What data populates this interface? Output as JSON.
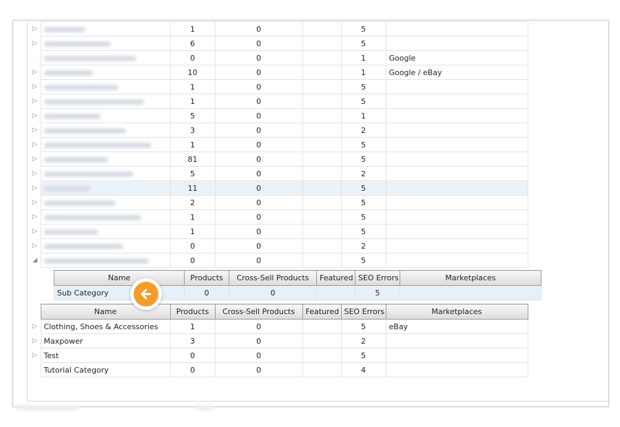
{
  "top_rows": [
    {
      "name": "",
      "expander": "▷",
      "products": "1",
      "cross_sell": "0",
      "featured": "",
      "seo_errors": "5",
      "marketplaces": ""
    },
    {
      "name": "",
      "expander": "▷",
      "products": "6",
      "cross_sell": "0",
      "featured": "",
      "seo_errors": "5",
      "marketplaces": ""
    },
    {
      "name": "",
      "expander": "",
      "products": "0",
      "cross_sell": "0",
      "featured": "",
      "seo_errors": "1",
      "marketplaces": "Google"
    },
    {
      "name": "",
      "expander": "▷",
      "products": "10",
      "cross_sell": "0",
      "featured": "",
      "seo_errors": "1",
      "marketplaces": "Google / eBay"
    },
    {
      "name": "",
      "expander": "▷",
      "products": "1",
      "cross_sell": "0",
      "featured": "",
      "seo_errors": "5",
      "marketplaces": ""
    },
    {
      "name": "",
      "expander": "▷",
      "products": "1",
      "cross_sell": "0",
      "featured": "",
      "seo_errors": "5",
      "marketplaces": ""
    },
    {
      "name": "",
      "expander": "▷",
      "products": "5",
      "cross_sell": "0",
      "featured": "",
      "seo_errors": "1",
      "marketplaces": ""
    },
    {
      "name": "",
      "expander": "▷",
      "products": "3",
      "cross_sell": "0",
      "featured": "",
      "seo_errors": "2",
      "marketplaces": ""
    },
    {
      "name": "",
      "expander": "▷",
      "products": "1",
      "cross_sell": "0",
      "featured": "",
      "seo_errors": "5",
      "marketplaces": ""
    },
    {
      "name": "",
      "expander": "▷",
      "products": "81",
      "cross_sell": "0",
      "featured": "",
      "seo_errors": "5",
      "marketplaces": ""
    },
    {
      "name": "",
      "expander": "▷",
      "products": "5",
      "cross_sell": "0",
      "featured": "",
      "seo_errors": "2",
      "marketplaces": ""
    },
    {
      "name": "",
      "expander": "▷",
      "products": "11",
      "cross_sell": "0",
      "featured": "",
      "seo_errors": "5",
      "marketplaces": ""
    },
    {
      "name": "",
      "expander": "▷",
      "products": "2",
      "cross_sell": "0",
      "featured": "",
      "seo_errors": "5",
      "marketplaces": ""
    },
    {
      "name": "",
      "expander": "▷",
      "products": "1",
      "cross_sell": "0",
      "featured": "",
      "seo_errors": "5",
      "marketplaces": ""
    },
    {
      "name": "",
      "expander": "▷",
      "products": "1",
      "cross_sell": "0",
      "featured": "",
      "seo_errors": "5",
      "marketplaces": ""
    },
    {
      "name": "",
      "expander": "▷",
      "products": "0",
      "cross_sell": "0",
      "featured": "",
      "seo_errors": "2",
      "marketplaces": ""
    },
    {
      "name": "",
      "expander": "◢",
      "products": "0",
      "cross_sell": "0",
      "featured": "",
      "seo_errors": "5",
      "marketplaces": ""
    }
  ],
  "selected_top_row": 11,
  "columns": {
    "name": "Name",
    "products": "Products",
    "cross_sell": "Cross-Sell Products",
    "featured": "Featured",
    "seo_errors": "SEO Errors",
    "marketplaces": "Marketplaces"
  },
  "sub_row": {
    "name": "Sub Category",
    "products": "0",
    "cross_sell": "0",
    "featured": "",
    "seo_errors": "5",
    "marketplaces": ""
  },
  "bottom_rows": [
    {
      "name": "Clothing, Shoes & Accessories",
      "expander": "▷",
      "products": "1",
      "cross_sell": "0",
      "featured": "",
      "seo_errors": "5",
      "marketplaces": "eBay"
    },
    {
      "name": "Maxpower",
      "expander": "▷",
      "products": "3",
      "cross_sell": "0",
      "featured": "",
      "seo_errors": "2",
      "marketplaces": ""
    },
    {
      "name": "Test",
      "expander": "▷",
      "products": "0",
      "cross_sell": "0",
      "featured": "",
      "seo_errors": "5",
      "marketplaces": ""
    },
    {
      "name": "Tutorial Category",
      "expander": "",
      "products": "0",
      "cross_sell": "0",
      "featured": "",
      "seo_errors": "4",
      "marketplaces": ""
    }
  ],
  "back_button": {
    "icon": "arrow-left-icon",
    "color": "#f39c29"
  },
  "colors": {
    "selected_row": "#eaf2fa",
    "sub_row": "#e5f0fa",
    "header_border": "#9a9a9a"
  }
}
